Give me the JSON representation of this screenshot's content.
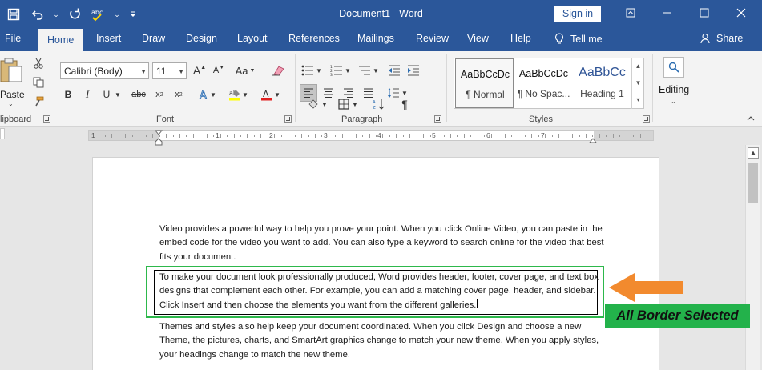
{
  "titlebar": {
    "title": "Document1  -  Word",
    "signin_label": "Sign in",
    "colors": {
      "bar": "#2b579a",
      "text": "#ffffff"
    },
    "quick_access_icons": [
      "save-icon",
      "undo-icon",
      "redo-icon",
      "spelling-icon",
      "customize-icon"
    ]
  },
  "tabs": [
    {
      "label": "File"
    },
    {
      "label": "Home",
      "active": true
    },
    {
      "label": "Insert"
    },
    {
      "label": "Draw"
    },
    {
      "label": "Design"
    },
    {
      "label": "Layout"
    },
    {
      "label": "References"
    },
    {
      "label": "Mailings"
    },
    {
      "label": "Review"
    },
    {
      "label": "View"
    },
    {
      "label": "Help"
    }
  ],
  "tell_me_label": "Tell me",
  "share_label": "Share",
  "ribbon": {
    "clipboard": {
      "paste_label": "Paste",
      "group_label": "lipboard"
    },
    "font": {
      "font_name": "Calibri (Body)",
      "font_size": "11",
      "group_label": "Font"
    },
    "paragraph": {
      "group_label": "Paragraph"
    },
    "styles": {
      "group_label": "Styles",
      "items": [
        {
          "preview": "AaBbCcDc",
          "label": "¶ Normal"
        },
        {
          "preview": "AaBbCcDc",
          "label": "¶ No Spac..."
        },
        {
          "preview": "AaBbCc",
          "label": "Heading 1"
        }
      ]
    },
    "editing": {
      "label": "Editing"
    }
  },
  "ruler": {
    "numbers": [
      "1",
      "1",
      "2",
      "3",
      "4",
      "5",
      "6",
      "7"
    ]
  },
  "document": {
    "paragraph1": "Video provides a powerful way to help you prove your point. When you click Online Video, you can paste in the embed code for the video you want to add. You can also type a keyword to search online for the video that best fits your document.",
    "paragraph2": "To make your document look professionally produced, Word provides header, footer, cover page, and text box designs that complement each other. For example, you can add a matching cover page, header, and sidebar. Click Insert and then choose the elements you want from the different galleries.",
    "paragraph3": "Themes and styles also help keep your document coordinated. When you click Design and choose a new Theme, the pictures, charts, and SmartArt graphics change to match your new theme. When you apply styles, your headings change to match the new theme."
  },
  "annotation": {
    "label": "All Border Selected",
    "colors": {
      "highlight": "#2db84b",
      "label_bg": "#23b24b",
      "arrow": "#f28a2e"
    }
  }
}
